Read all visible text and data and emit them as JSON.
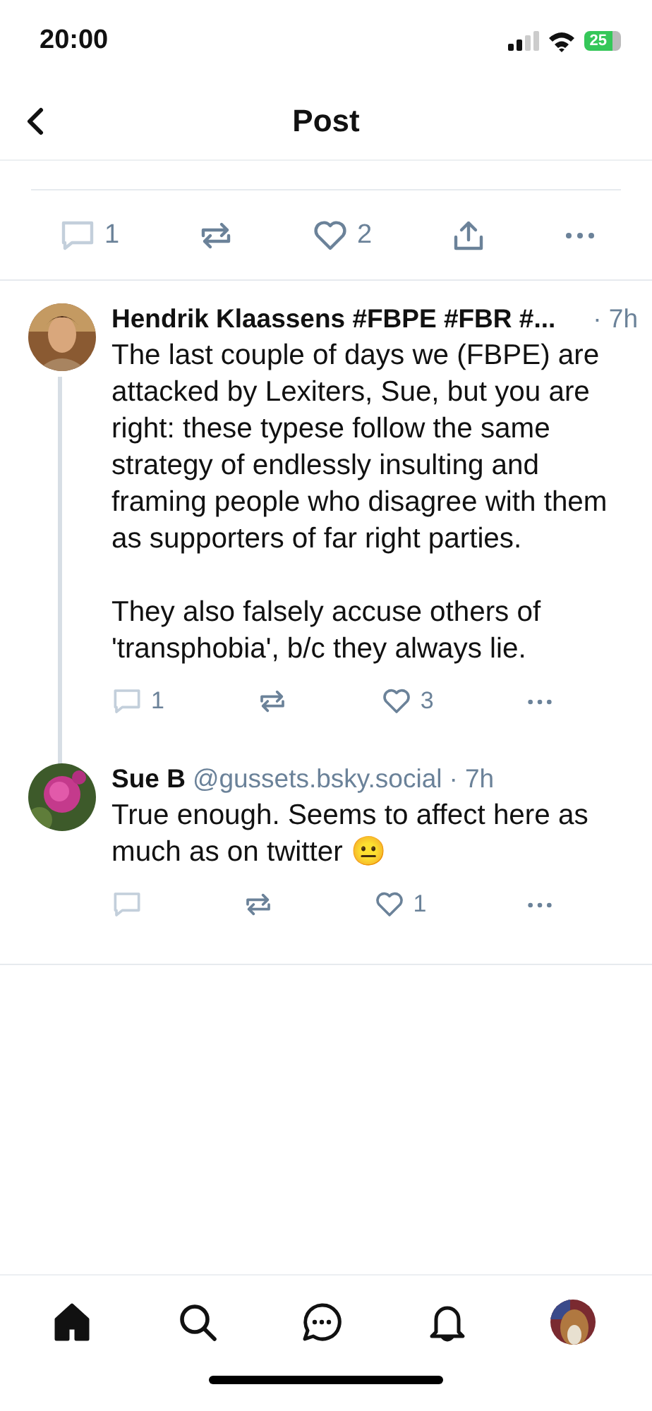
{
  "status_bar": {
    "time": "20:00",
    "battery": "25"
  },
  "header": {
    "title": "Post"
  },
  "post_actions": [
    {
      "kind": "reply",
      "count": "1"
    },
    {
      "kind": "repost"
    },
    {
      "kind": "like",
      "count": "2"
    },
    {
      "kind": "share"
    },
    {
      "kind": "more"
    }
  ],
  "replies": [
    {
      "author": "Hendrik Klaassens #FBPE #FBR #...",
      "time": "· 7h",
      "paragraphs": [
        "The last couple of days we (FBPE) are attacked by Lexiters, Sue, but you are right: these typese follow the same strategy of endlessly insulting and framing people who disagree with them as supporters of far right parties.",
        "They also falsely accuse others of 'transphobia', b/c they always lie."
      ],
      "actions": [
        {
          "kind": "reply",
          "count": "1"
        },
        {
          "kind": "repost"
        },
        {
          "kind": "like",
          "count": "3"
        },
        {
          "kind": "more"
        }
      ]
    },
    {
      "author": "Sue B",
      "handle": "@gussets.bsky.social",
      "time": "· 7h",
      "paragraphs": [
        "True enough. Seems to affect here as much as on twitter 😐"
      ],
      "actions": [
        {
          "kind": "reply"
        },
        {
          "kind": "repost"
        },
        {
          "kind": "like",
          "count": "1"
        },
        {
          "kind": "more"
        }
      ]
    }
  ],
  "nav": [
    {
      "kind": "home",
      "selected": true
    },
    {
      "kind": "search",
      "selected": false
    },
    {
      "kind": "chat",
      "selected": false
    },
    {
      "kind": "bell",
      "selected": false
    },
    {
      "kind": "profile",
      "selected": false
    }
  ]
}
